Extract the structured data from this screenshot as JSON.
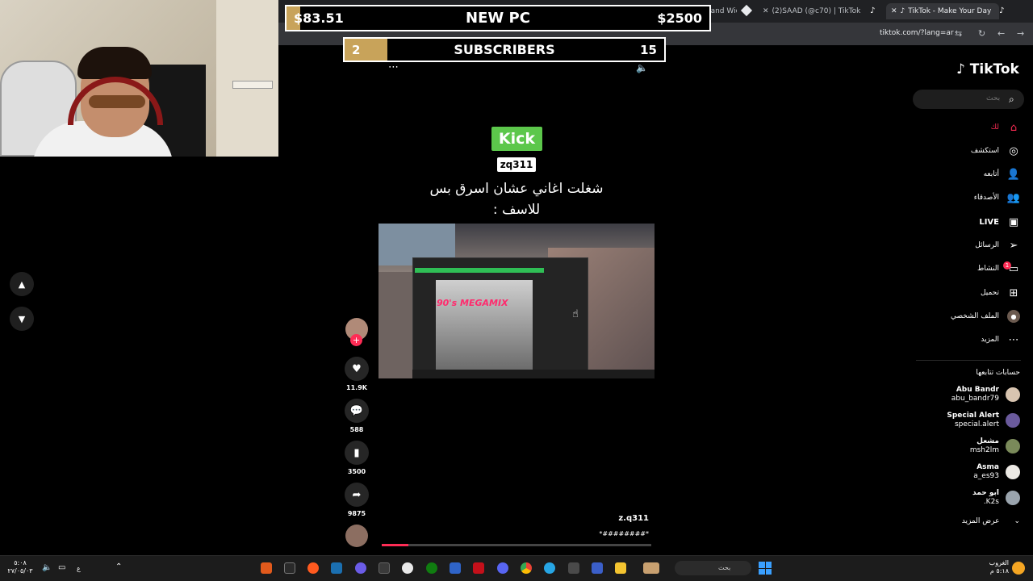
{
  "browser": {
    "tabs": [
      {
        "label": "The best ChatBot and Widgets",
        "active": false
      },
      {
        "label": "(2)SAAD (@c70) | TikTok",
        "active": false
      },
      {
        "label": "TikTok - Make Your Day",
        "active": true
      }
    ],
    "url": "tiktok.com/?lang=ar"
  },
  "overlay": {
    "goal_pc": {
      "current": "$83.51",
      "label": "NEW PC",
      "target": "$2500",
      "progress": 0.033
    },
    "goal_subs": {
      "current": "2",
      "label": "SUBSCRIBERS",
      "target": "15",
      "progress": 0.133
    }
  },
  "tiktok": {
    "logo": "TikTok",
    "search_placeholder": "بحث",
    "nav": [
      {
        "label": "لك",
        "icon": "home-icon",
        "active": true
      },
      {
        "label": "استكشف",
        "icon": "compass-icon",
        "active": false
      },
      {
        "label": "أتابعه",
        "icon": "following-icon",
        "active": false
      },
      {
        "label": "الأصدقاء",
        "icon": "friends-icon",
        "active": false
      },
      {
        "label": "LIVE",
        "icon": "live-icon",
        "active": false
      },
      {
        "label": "الرسائل",
        "icon": "messages-icon",
        "active": false
      },
      {
        "label": "النشاط",
        "icon": "activity-icon",
        "active": false
      },
      {
        "label": "تحميل",
        "icon": "upload-icon",
        "active": false
      },
      {
        "label": "الملف الشخصي",
        "icon": "profile-icon",
        "active": false
      },
      {
        "label": "المزيد",
        "icon": "more-icon",
        "active": false
      }
    ],
    "activity_badge": "1",
    "following_title": "حسابات تتابعها",
    "following": [
      {
        "name": "Abu Bandr",
        "handle": "abu_bandr79"
      },
      {
        "name": "Special Alert",
        "handle": "special.alert"
      },
      {
        "name": "مشعل",
        "handle": "msh2lm"
      },
      {
        "name": "Asma",
        "handle": "a_es93"
      },
      {
        "name": "ابو حمد",
        "handle": ".K2s"
      }
    ],
    "see_more": "عرض المزيد"
  },
  "video": {
    "kick_label": "Kick",
    "username_badge": "zq311",
    "caption_line1": "شغلت اغاني عشان اسرق بس",
    "caption_line2": "للاسف :",
    "cover_text": "90's MEGAMIX",
    "likes": "11.9K",
    "comments": "588",
    "saves": "3500",
    "shares": "9875",
    "author": "z.q311",
    "description": "*########*",
    "progress": 0.1
  },
  "taskbar": {
    "search_placeholder": "بحث",
    "weather": "الغروب",
    "time": "٥:١٨ م",
    "clock_time": "٥:٠٨",
    "clock_date": "٢٧/٠٥/٠٣",
    "lang": "ع"
  }
}
